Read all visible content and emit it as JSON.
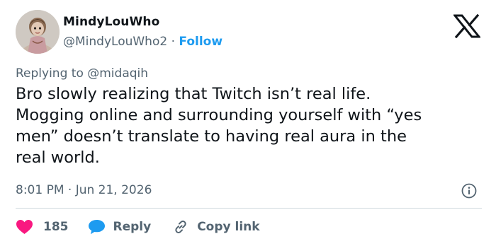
{
  "author": {
    "display_name": "MindyLouWho",
    "handle": "@MindyLouWho2",
    "separator": "·",
    "follow_label": "Follow"
  },
  "reply_context": {
    "prefix": "Replying to",
    "target": "@midaqih"
  },
  "tweet": {
    "lines": [
      "Bro slowly realizing that Twitch isn’t real life.",
      "Mogging online and surrounding yourself with “yes",
      "men” doesn’t translate to having real aura in the",
      "real world."
    ],
    "timestamp": "8:01 PM · Jun 21, 2026"
  },
  "actions": {
    "like_count": "185",
    "reply_label": "Reply",
    "copy_label": "Copy link"
  },
  "colors": {
    "accent": "#1d9bf0",
    "like": "#f91880",
    "muted": "#536471",
    "text": "#0f1419",
    "divider": "#cfd9de"
  },
  "icons": [
    "x-logo-icon",
    "info-icon",
    "heart-icon",
    "reply-bubble-icon",
    "link-icon"
  ]
}
